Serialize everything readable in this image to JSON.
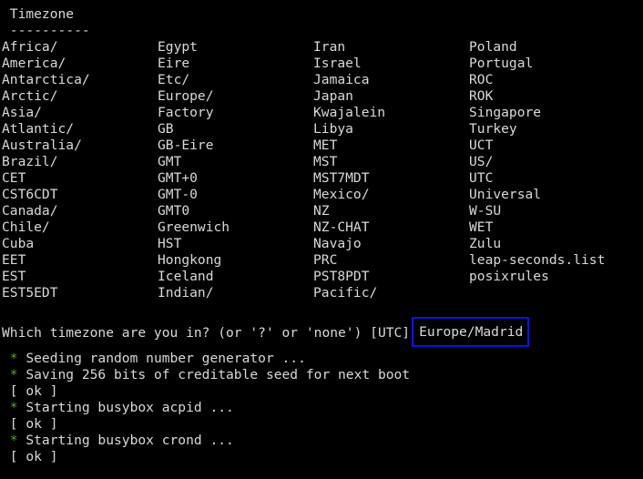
{
  "terminal": {
    "colors": {
      "background": "#000000",
      "text": "#d9d9d9",
      "bullet": "#4caf2a",
      "highlight_box": "#1010e0"
    },
    "heading": " Timezone",
    "separator": " ----------",
    "timezones": [
      [
        "Africa/",
        "Egypt",
        "Iran",
        "Poland"
      ],
      [
        "America/",
        "Eire",
        "Israel",
        "Portugal"
      ],
      [
        "Antarctica/",
        "Etc/",
        "Jamaica",
        "ROC"
      ],
      [
        "Arctic/",
        "Europe/",
        "Japan",
        "ROK"
      ],
      [
        "Asia/",
        "Factory",
        "Kwajalein",
        "Singapore"
      ],
      [
        "Atlantic/",
        "GB",
        "Libya",
        "Turkey"
      ],
      [
        "Australia/",
        "GB-Eire",
        "MET",
        "UCT"
      ],
      [
        "Brazil/",
        "GMT",
        "MST",
        "US/"
      ],
      [
        "CET",
        "GMT+0",
        "MST7MDT",
        "UTC"
      ],
      [
        "CST6CDT",
        "GMT-0",
        "Mexico/",
        "Universal"
      ],
      [
        "Canada/",
        "GMT0",
        "NZ",
        "W-SU"
      ],
      [
        "Chile/",
        "Greenwich",
        "NZ-CHAT",
        "WET"
      ],
      [
        "Cuba",
        "HST",
        "Navajo",
        "Zulu"
      ],
      [
        "EET",
        "Hongkong",
        "PRC",
        "leap-seconds.list"
      ],
      [
        "EST",
        "Iceland",
        "PST8PDT",
        "posixrules"
      ],
      [
        "EST5EDT",
        "Indian/",
        "Pacific/",
        ""
      ]
    ],
    "prompt": "Which timezone are you in? (or '?' or 'none') [UTC]",
    "answer": "Europe/Madrid",
    "boot_log": [
      {
        "bullet": " * ",
        "text": "Seeding random number generator ..."
      },
      {
        "bullet": " * ",
        "text": "Saving 256 bits of creditable seed for next boot"
      },
      {
        "bullet": "",
        "text": " [ ok ]"
      },
      {
        "bullet": " * ",
        "text": "Starting busybox acpid ..."
      },
      {
        "bullet": "",
        "text": " [ ok ]"
      },
      {
        "bullet": " * ",
        "text": "Starting busybox crond ..."
      },
      {
        "bullet": "",
        "text": " [ ok ]"
      }
    ]
  }
}
